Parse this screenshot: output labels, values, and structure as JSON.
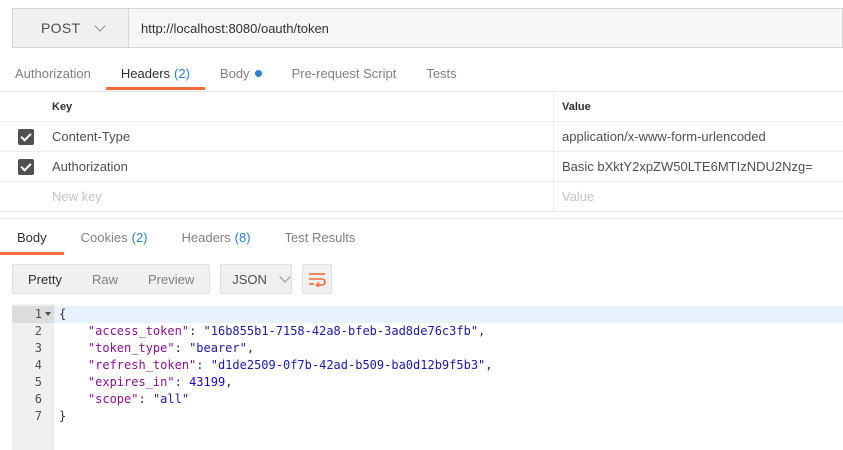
{
  "request": {
    "method": "POST",
    "url": "http://localhost:8080/oauth/token"
  },
  "request_tabs": [
    {
      "label": "Authorization",
      "count": "",
      "dot": false,
      "active": false
    },
    {
      "label": "Headers",
      "count": "(2)",
      "dot": false,
      "active": true
    },
    {
      "label": "Body",
      "count": "",
      "dot": true,
      "active": false
    },
    {
      "label": "Pre-request Script",
      "count": "",
      "dot": false,
      "active": false
    },
    {
      "label": "Tests",
      "count": "",
      "dot": false,
      "active": false
    }
  ],
  "headers_table": {
    "key_header": "Key",
    "value_header": "Value",
    "rows": [
      {
        "key": "Content-Type",
        "value": "application/x-www-form-urlencoded",
        "checked": true
      },
      {
        "key": "Authorization",
        "value": "Basic bXktY2xpZW50LTE6MTIzNDU2Nzg=",
        "checked": true
      }
    ],
    "key_placeholder": "New key",
    "value_placeholder": "Value"
  },
  "response_tabs": [
    {
      "label": "Body",
      "count": "",
      "active": true
    },
    {
      "label": "Cookies",
      "count": "(2)",
      "active": false
    },
    {
      "label": "Headers",
      "count": "(8)",
      "active": false
    },
    {
      "label": "Test Results",
      "count": "",
      "active": false
    }
  ],
  "toolbar": {
    "pretty": "Pretty",
    "raw": "Raw",
    "preview": "Preview",
    "format": "JSON"
  },
  "response_body": {
    "line_numbers": [
      "1",
      "2",
      "3",
      "4",
      "5",
      "6",
      "7"
    ],
    "open_brace": "{",
    "close_brace": "}",
    "fields": [
      {
        "key": "\"access_token\"",
        "value": "\"16b855b1-7158-42a8-bfeb-3ad8de76c3fb\"",
        "type": "string"
      },
      {
        "key": "\"token_type\"",
        "value": "\"bearer\"",
        "type": "string"
      },
      {
        "key": "\"refresh_token\"",
        "value": "\"d1de2509-0f7b-42ad-b509-ba0d12b9f5b3\"",
        "type": "string"
      },
      {
        "key": "\"expires_in\"",
        "value": "43199",
        "type": "number"
      },
      {
        "key": "\"scope\"",
        "value": "\"all\"",
        "type": "string"
      }
    ]
  },
  "colors": {
    "accent": "#f26b3a",
    "count_blue": "#2a82d3"
  }
}
